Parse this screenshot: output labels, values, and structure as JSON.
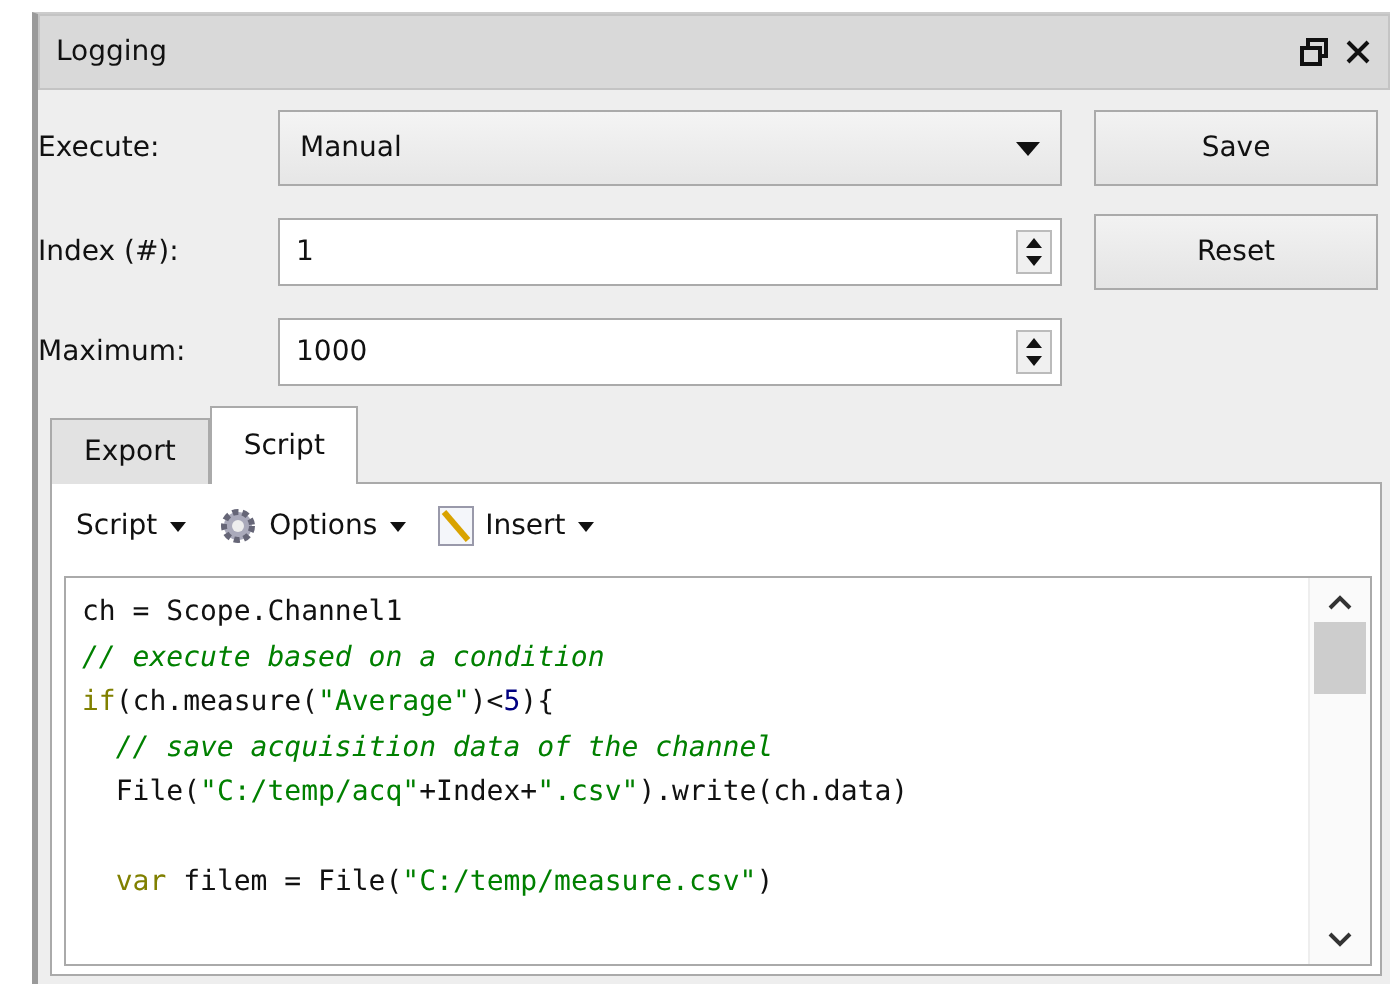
{
  "panel": {
    "title": "Logging"
  },
  "form": {
    "execute": {
      "label": "Execute:",
      "value": "Manual"
    },
    "index": {
      "label": "Index (#):",
      "value": "1"
    },
    "maximum": {
      "label": "Maximum:",
      "value": "1000"
    },
    "buttons": [
      "Save",
      "Reset"
    ]
  },
  "tabs": [
    {
      "label": "Export",
      "selected": false
    },
    {
      "label": "Script",
      "selected": true
    }
  ],
  "toolbar": [
    {
      "kind": "plain",
      "label": "Script"
    },
    {
      "kind": "gear",
      "label": "Options"
    },
    {
      "kind": "pencil",
      "label": "Insert"
    }
  ],
  "editor": {
    "lines": [
      {
        "kind": "code",
        "tokens": [
          {
            "kind": "plain",
            "text": "ch = Scope.Channel1"
          }
        ]
      },
      {
        "kind": "code",
        "tokens": [
          {
            "kind": "comment",
            "text": "// execute based on a condition"
          }
        ]
      },
      {
        "kind": "code",
        "tokens": [
          {
            "kind": "keyword",
            "text": "if"
          },
          {
            "kind": "plain",
            "text": "(ch.measure("
          },
          {
            "kind": "string",
            "text": "\"Average\""
          },
          {
            "kind": "plain",
            "text": ")<"
          },
          {
            "kind": "number",
            "text": "5"
          },
          {
            "kind": "plain",
            "text": "){"
          }
        ]
      },
      {
        "kind": "code",
        "tokens": [
          {
            "kind": "comment",
            "text": "  // save acquisition data of the channel"
          }
        ]
      },
      {
        "kind": "code",
        "tokens": [
          {
            "kind": "plain",
            "text": "  File("
          },
          {
            "kind": "string",
            "text": "\"C:/temp/acq\""
          },
          {
            "kind": "plain",
            "text": "+Index+"
          },
          {
            "kind": "string",
            "text": "\".csv\""
          },
          {
            "kind": "plain",
            "text": ").write(ch.data)"
          }
        ]
      },
      {
        "kind": "blank"
      },
      {
        "kind": "code",
        "tokens": [
          {
            "kind": "keyword",
            "text": "  var"
          },
          {
            "kind": "plain",
            "text": " filem = File("
          },
          {
            "kind": "string",
            "text": "\"C:/temp/measure.csv\""
          },
          {
            "kind": "plain",
            "text": ")"
          }
        ]
      }
    ]
  }
}
